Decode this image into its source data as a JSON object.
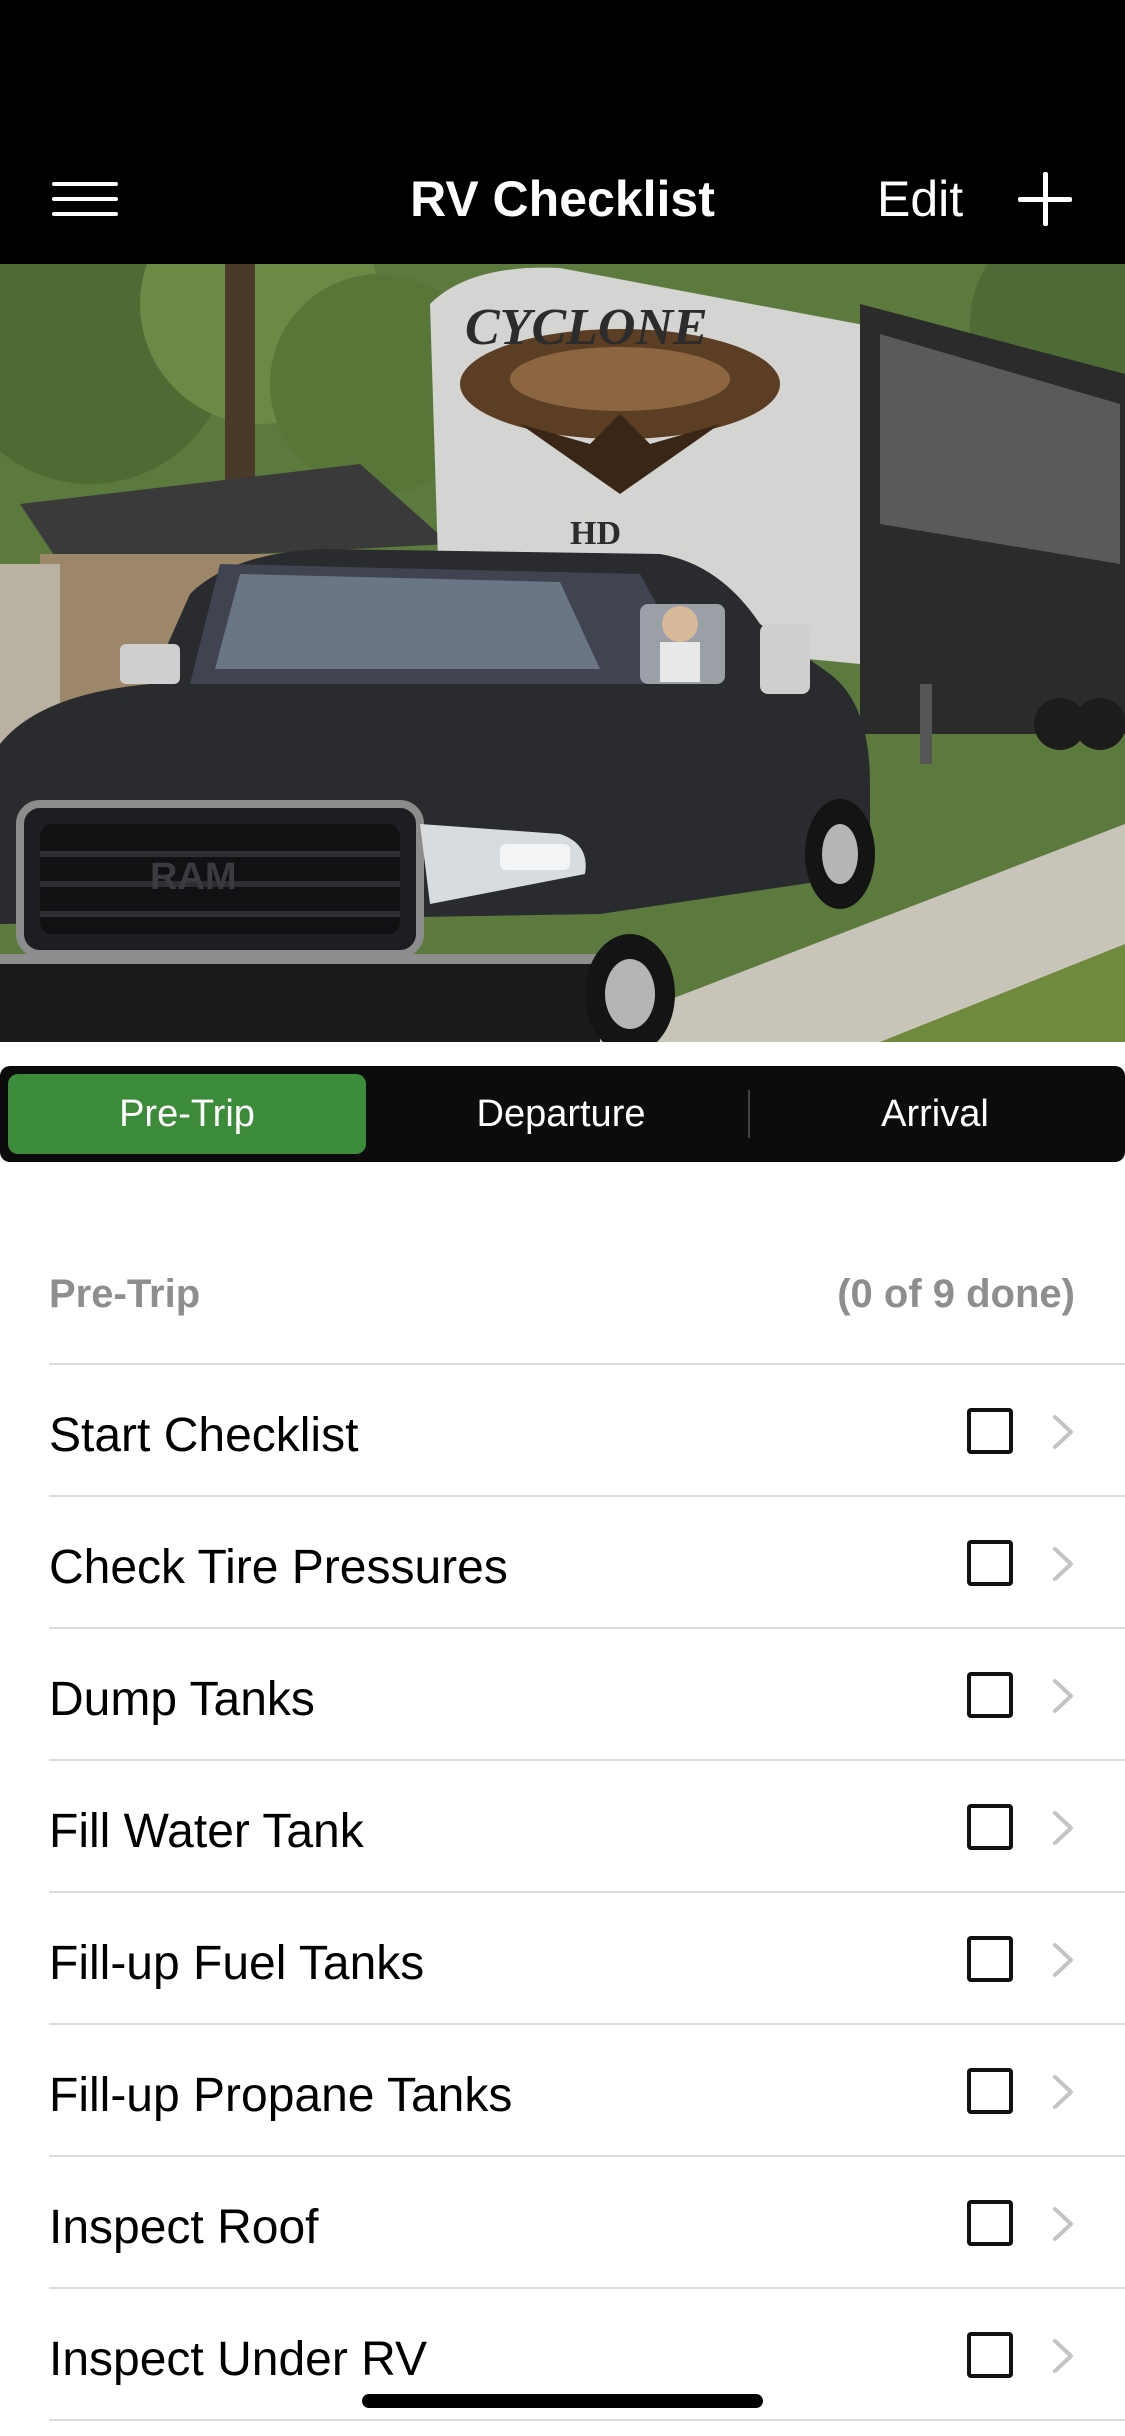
{
  "nav": {
    "title": "RV Checklist",
    "edit_label": "Edit",
    "menu_icon": "hamburger-menu-icon",
    "add_icon": "plus-icon"
  },
  "hero": {
    "description": "Header photo of a dark pickup truck towing a fifth-wheel RV",
    "rv_brand_text": "CYCLONE",
    "rv_badge_text": "HD",
    "truck_grille_text": "RAM"
  },
  "segments": {
    "selected": "Pre-Trip",
    "items": [
      {
        "label": "Pre-Trip"
      },
      {
        "label": "Departure"
      },
      {
        "label": "Arrival"
      }
    ]
  },
  "checklist": {
    "section_title": "Pre-Trip",
    "progress_text": "(0 of 9 done)",
    "items": [
      {
        "label": "Start Checklist",
        "checked": false
      },
      {
        "label": "Check Tire Pressures",
        "checked": false
      },
      {
        "label": "Dump Tanks",
        "checked": false
      },
      {
        "label": "Fill Water Tank",
        "checked": false
      },
      {
        "label": "Fill-up Fuel Tanks",
        "checked": false
      },
      {
        "label": "Fill-up Propane Tanks",
        "checked": false
      },
      {
        "label": "Inspect Roof",
        "checked": false
      },
      {
        "label": "Inspect Under RV",
        "checked": false
      }
    ]
  },
  "colors": {
    "accent_green": "#3b8b3a",
    "nav_background": "#000000",
    "secondary_text": "#8e8e8e"
  }
}
